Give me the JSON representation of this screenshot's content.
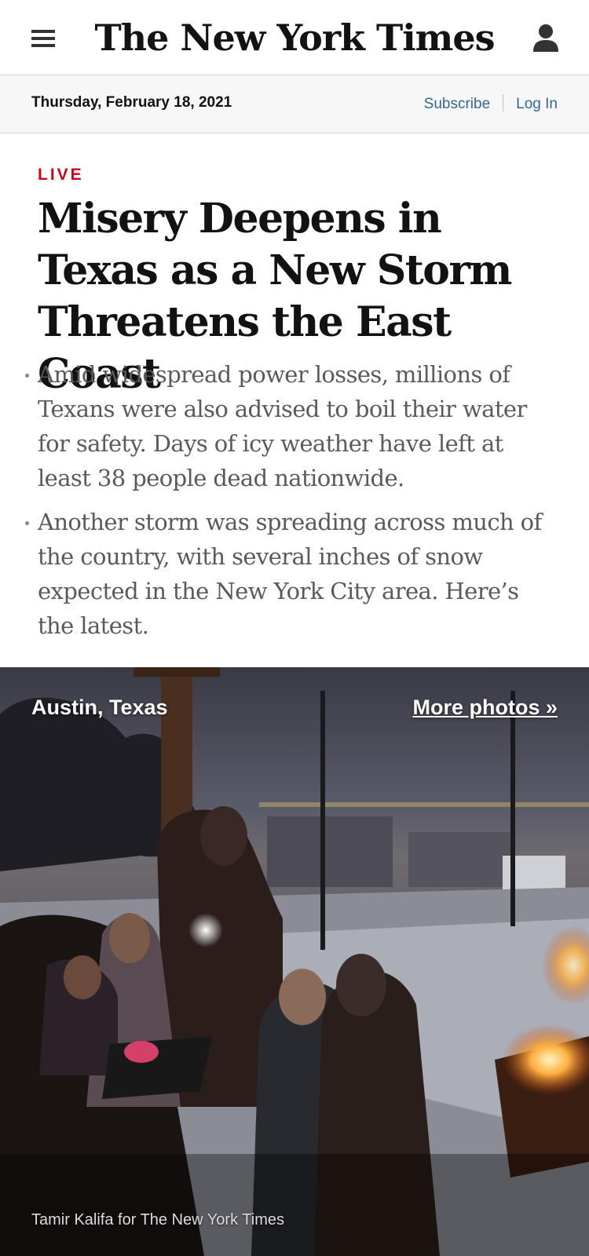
{
  "header": {
    "logo_text": "The New York Times",
    "menu_icon": "hamburger-menu-icon",
    "account_icon": "user-account-icon"
  },
  "datebar": {
    "date": "Thursday, February 18, 2021",
    "subscribe_label": "Subscribe",
    "login_label": "Log In"
  },
  "article": {
    "kicker": "LIVE",
    "headline": "Misery Deepens in Texas as a New Storm Threatens the East Coast",
    "summary": [
      "Amid widespread power losses, millions of Texans were also advised to boil their water for safety. Days of icy weather have left at least 38 people dead nationwide.",
      "Another storm was spreading across much of the country, with several inches of snow expected in the New York City area. Here’s the latest."
    ]
  },
  "photo": {
    "location": "Austin, Texas",
    "more_photos_label": "More photos »",
    "credit": "Tamir Kalifa for The New York Times"
  },
  "colors": {
    "accent_live": "#d0021b",
    "link": "#326891",
    "text": "#121212",
    "summary_text": "#5a5a5a"
  }
}
